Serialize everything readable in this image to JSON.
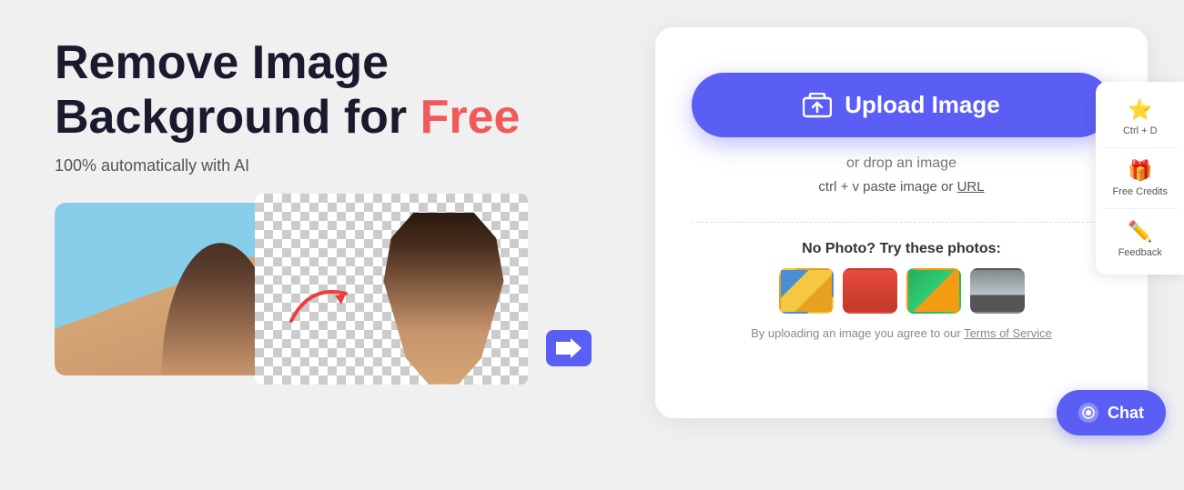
{
  "headline": {
    "line1": "Remove Image",
    "line2": "Background for ",
    "free": "Free"
  },
  "subtitle": "100% automatically with AI",
  "upload": {
    "button_label": "Upload Image",
    "or_drop": "or drop an image",
    "paste_hint": "ctrl + v paste image or ",
    "url_link": "URL"
  },
  "try_photos": {
    "label": "No Photo? Try these photos:"
  },
  "tos": {
    "text": "By uploading an image you agree to our ",
    "link_text": "Terms of Service"
  },
  "sidebar": {
    "items": [
      {
        "id": "bookmark",
        "icon": "⭐",
        "label": "Ctrl + D"
      },
      {
        "id": "credits",
        "icon": "🎁",
        "label": "Free Credits"
      },
      {
        "id": "feedback",
        "icon": "✏️",
        "label": "Feedback"
      }
    ]
  },
  "chat": {
    "label": "Chat"
  },
  "colors": {
    "accent": "#5b5ef4",
    "free_color": "#f05a5a",
    "headline_color": "#1a1a2e"
  }
}
